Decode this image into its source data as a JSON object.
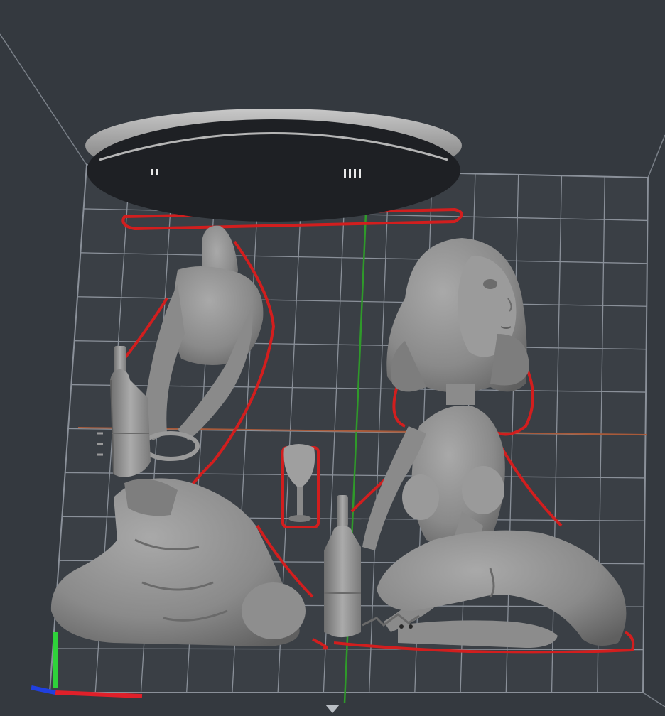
{
  "viewport": {
    "background_color": "#34393f",
    "build_plate_color": "#3a3f45",
    "grid_color": "#8a9099",
    "model_color": "#8f8f8f",
    "model_shadow_color": "#5c5c5c",
    "support_color": "#1e2024",
    "support_rim_color": "#a8a8a8",
    "overhang_color": "#d21e1e",
    "axis_x_color": "#e0202a",
    "axis_y_color": "#2fd23a",
    "axis_z_color": "#2040e0",
    "center_line_color": "#2f9a2a",
    "horizon_line_color": "#a85a3a"
  },
  "objects": [
    {
      "name": "support-disc",
      "icon": "disc-icon"
    },
    {
      "name": "figure-left",
      "icon": "figure-icon"
    },
    {
      "name": "figure-right",
      "icon": "figure-icon"
    },
    {
      "name": "bottle-left",
      "icon": "bottle-icon"
    },
    {
      "name": "bottle-center",
      "icon": "bottle-icon"
    },
    {
      "name": "wine-glass",
      "icon": "glass-icon"
    }
  ]
}
